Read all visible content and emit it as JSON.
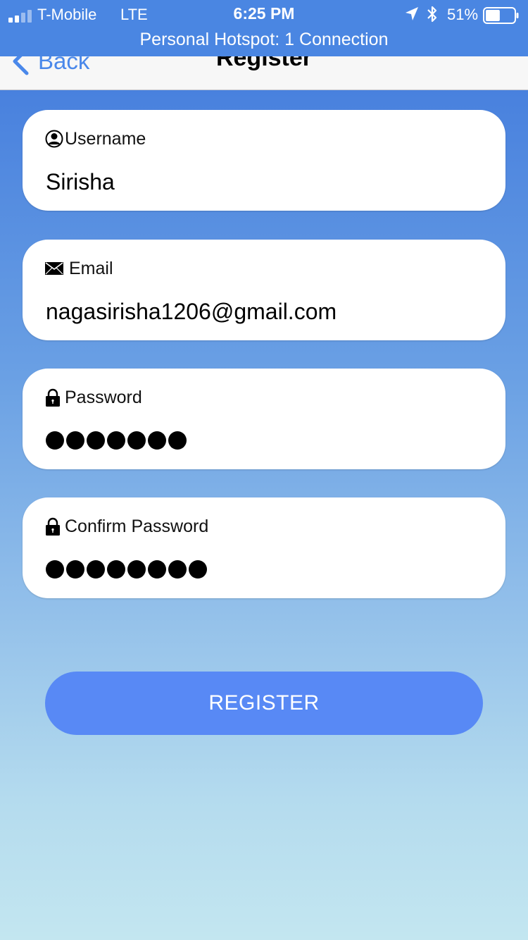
{
  "status_bar": {
    "carrier": "T-Mobile",
    "network": "LTE",
    "time": "6:25 PM",
    "battery_percent": "51%",
    "battery_level": 0.51,
    "signal_bars_filled": 2,
    "signal_bars_total": 4,
    "hotspot_text": "Personal Hotspot: 1 Connection",
    "bar_color": "#4a86e2"
  },
  "nav": {
    "back_label": "Back",
    "title": "Register",
    "accent_color": "#4a88ea"
  },
  "form": {
    "username": {
      "label": "Username",
      "value": "Sirisha",
      "icon": "user-icon"
    },
    "email": {
      "label": "Email",
      "value": "nagasirisha1206@gmail.com",
      "icon": "envelope-icon"
    },
    "password": {
      "label": "Password",
      "masked_length": 7,
      "icon": "lock-icon"
    },
    "confirm_password": {
      "label": "Confirm Password",
      "masked_length": 8,
      "icon": "lock-icon"
    }
  },
  "register_button": {
    "label": "REGISTER",
    "color": "#5889f5"
  }
}
